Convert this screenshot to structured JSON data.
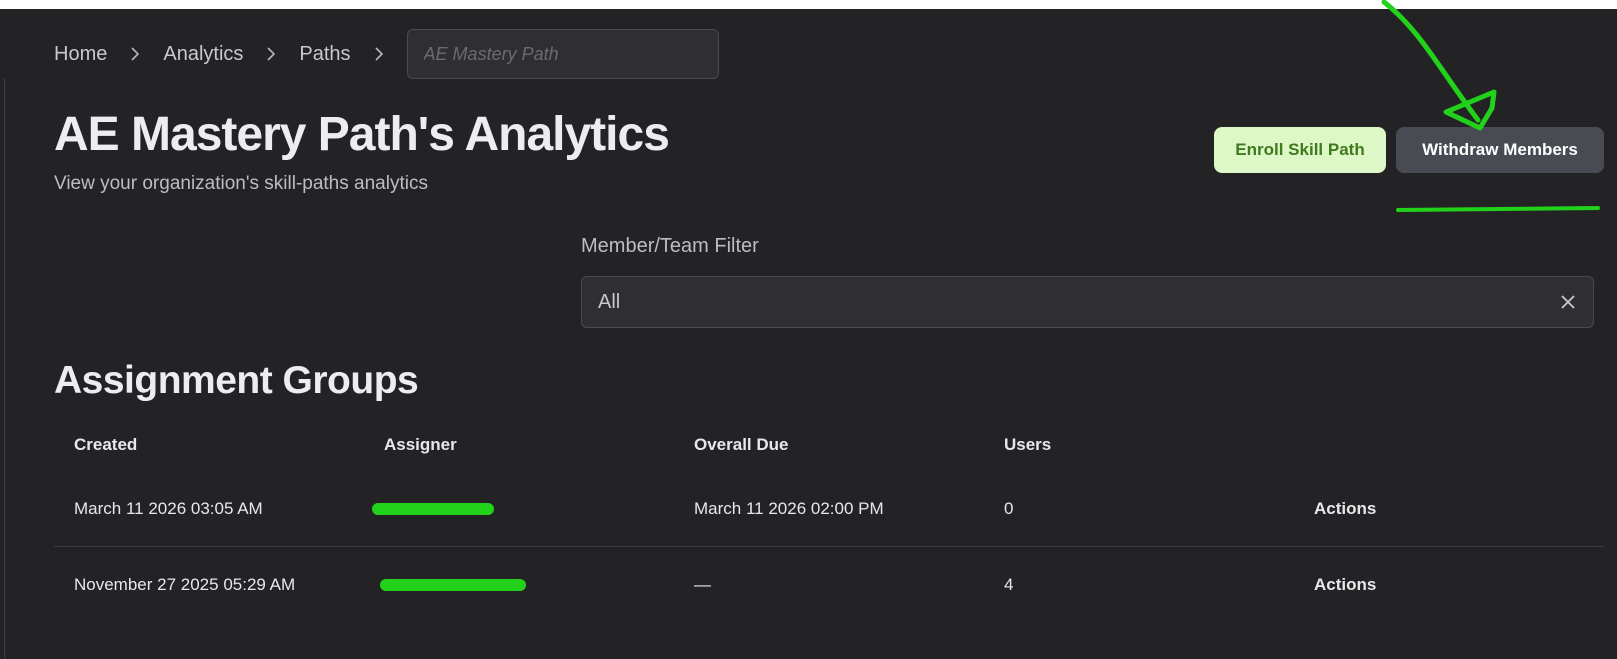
{
  "breadcrumb": {
    "home": "Home",
    "analytics": "Analytics",
    "paths": "Paths",
    "current_placeholder": "AE Mastery Path"
  },
  "header": {
    "title": "AE Mastery Path's Analytics",
    "subtitle": "View your organization's skill-paths analytics"
  },
  "buttons": {
    "enroll": "Enroll Skill Path",
    "withdraw": "Withdraw Members"
  },
  "filter": {
    "label": "Member/Team Filter",
    "value": "All"
  },
  "assignment_groups": {
    "title": "Assignment Groups",
    "columns": [
      "Created",
      "Assigner",
      "Overall Due",
      "Users"
    ],
    "rows": [
      {
        "created": "March 11 2026 03:05 AM",
        "overall_due": "March 11 2026 02:00 PM",
        "users": "0",
        "actions": "Actions"
      },
      {
        "created": "November 27 2025 05:29 AM",
        "overall_due": "—",
        "users": "4",
        "actions": "Actions"
      }
    ]
  },
  "colors": {
    "background": "#232326",
    "enroll_bg": "#ddf7c6",
    "enroll_text": "#3f7a1f",
    "withdraw_bg": "#484b52",
    "annotation_green": "#22d21a"
  },
  "icons": {
    "breadcrumb_separator": "chevron-right-icon",
    "filter_clear": "close-icon"
  }
}
